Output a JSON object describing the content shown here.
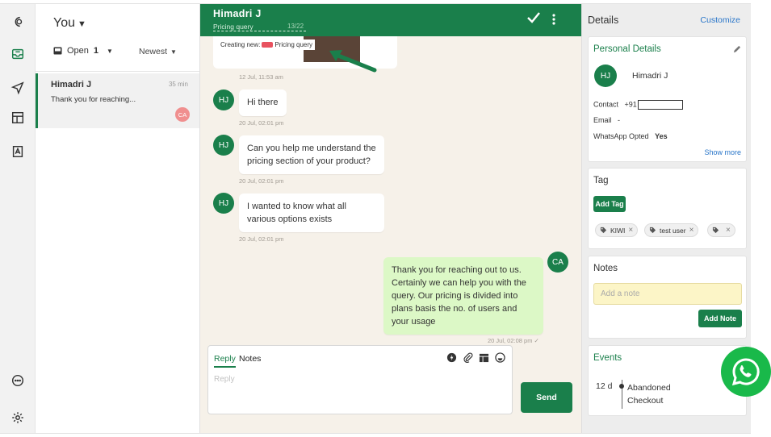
{
  "conversation_list": {
    "owner_label": "You",
    "filter_label": "Open",
    "filter_count": "1",
    "sort_label": "Newest",
    "items": [
      {
        "name": "Himadri J",
        "time": "35 min",
        "preview": "Thank you for reaching...",
        "assignee_initials": "CA"
      }
    ]
  },
  "chat": {
    "contact_name": "Himadri J",
    "conversation_label": "Pricing query",
    "page_indicator": "13/22",
    "popup_prefix": "Creating new:",
    "popup_tag": "Pricing query",
    "messages": [
      {
        "direction": "system",
        "timestamp": "12 Jul, 11:53 am"
      },
      {
        "direction": "in",
        "avatar": "HJ",
        "text": "Hi there",
        "timestamp": "20 Jul, 02:01 pm"
      },
      {
        "direction": "in",
        "avatar": "HJ",
        "lines": [
          "Can you help me understand the",
          "pricing section of your product?"
        ],
        "timestamp": "20 Jul, 02:01 pm"
      },
      {
        "direction": "in",
        "avatar": "HJ",
        "lines": [
          "I wanted to know what all",
          "various options exists"
        ],
        "timestamp": "20 Jul, 02:01 pm"
      },
      {
        "direction": "out",
        "avatar": "CA",
        "lines": [
          "Thank you for reaching out to us.",
          "Certainly we can help you with the",
          "query. Our pricing is divided into",
          "plans basis the no. of users and",
          "your usage"
        ],
        "timestamp": "20 Jul, 02:08 pm"
      }
    ],
    "composer": {
      "tab_reply": "Reply",
      "tab_notes": "Notes",
      "placeholder": "Reply",
      "send_label": "Send"
    }
  },
  "details": {
    "title": "Details",
    "customize_label": "Customize",
    "personal": {
      "title": "Personal Details",
      "initials": "HJ",
      "name": "Himadri J",
      "contact_label": "Contact",
      "contact_value": "+91",
      "email_label": "Email",
      "email_value": "-",
      "whatsapp_label": "WhatsApp Opted",
      "whatsapp_value": "Yes",
      "show_more": "Show more"
    },
    "tags": {
      "title": "Tag",
      "add_label": "Add Tag",
      "chips": [
        "KIWI",
        "test user",
        ""
      ]
    },
    "notes": {
      "title": "Notes",
      "placeholder": "Add a note",
      "add_label": "Add Note"
    },
    "events": {
      "title": "Events",
      "items": [
        {
          "age": "12 d",
          "lines": [
            "Abandoned",
            "Checkout"
          ]
        }
      ]
    }
  },
  "colors": {
    "brand_green": "#1a7f4b",
    "chat_bg": "#f6f1e9",
    "outgoing_bubble": "#dcf8c6",
    "link_blue": "#2a76c9",
    "whatsapp_green": "#19b94a"
  }
}
